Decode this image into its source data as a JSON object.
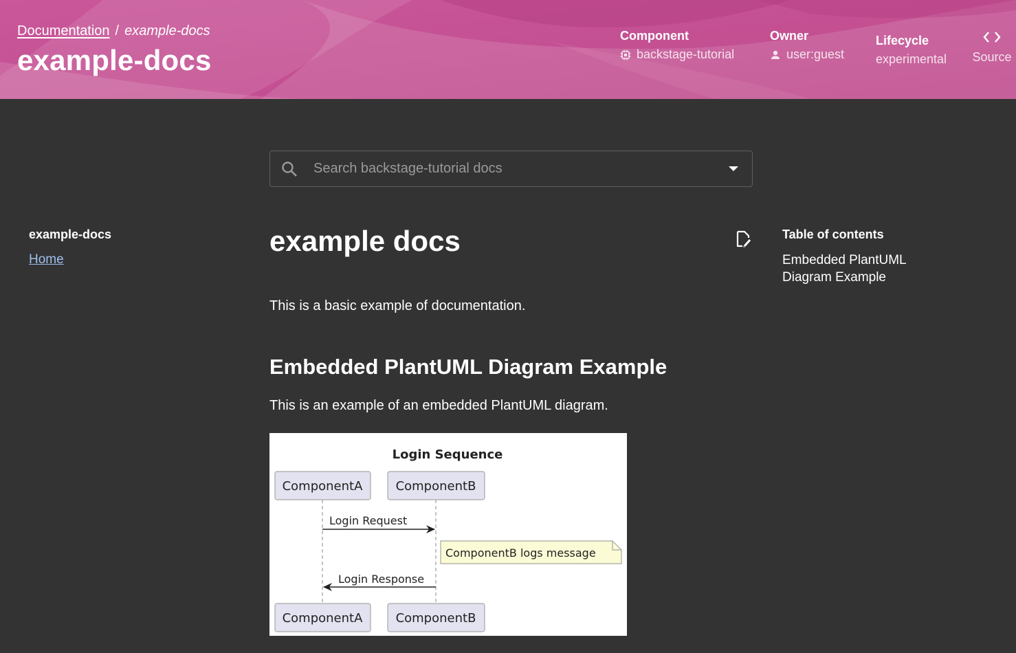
{
  "header": {
    "breadcrumb": {
      "root": "Documentation",
      "separator": "/",
      "current": "example-docs"
    },
    "title": "example-docs",
    "meta": {
      "component": {
        "label": "Component",
        "value": "backstage-tutorial",
        "icon": "chip-icon"
      },
      "owner": {
        "label": "Owner",
        "value": "user:guest",
        "icon": "person-icon"
      },
      "lifecycle": {
        "label": "Lifecycle",
        "value": "experimental"
      },
      "source": {
        "label": "Source",
        "icon": "code-icon"
      }
    },
    "colors": {
      "background": "#c2488b",
      "body": "#333333"
    }
  },
  "search": {
    "placeholder": "Search backstage-tutorial docs",
    "value": ""
  },
  "sidebar": {
    "title": "example-docs",
    "items": [
      {
        "label": "Home"
      }
    ]
  },
  "content": {
    "title": "example docs",
    "intro": "This is a basic example of documentation.",
    "section_heading": "Embedded PlantUML Diagram Example",
    "section_text": "This is an example of an embedded PlantUML diagram.",
    "diagram": {
      "title": "Login Sequence",
      "participants": [
        "ComponentA",
        "ComponentB"
      ],
      "messages": [
        {
          "from": "ComponentA",
          "to": "ComponentB",
          "label": "Login Request"
        },
        {
          "from": "ComponentB",
          "to": "ComponentA",
          "label": "Login Response"
        }
      ],
      "note": "ComponentB logs message"
    }
  },
  "toc": {
    "title": "Table of contents",
    "items": [
      {
        "label": "Embedded PlantUML Diagram Example"
      }
    ]
  }
}
